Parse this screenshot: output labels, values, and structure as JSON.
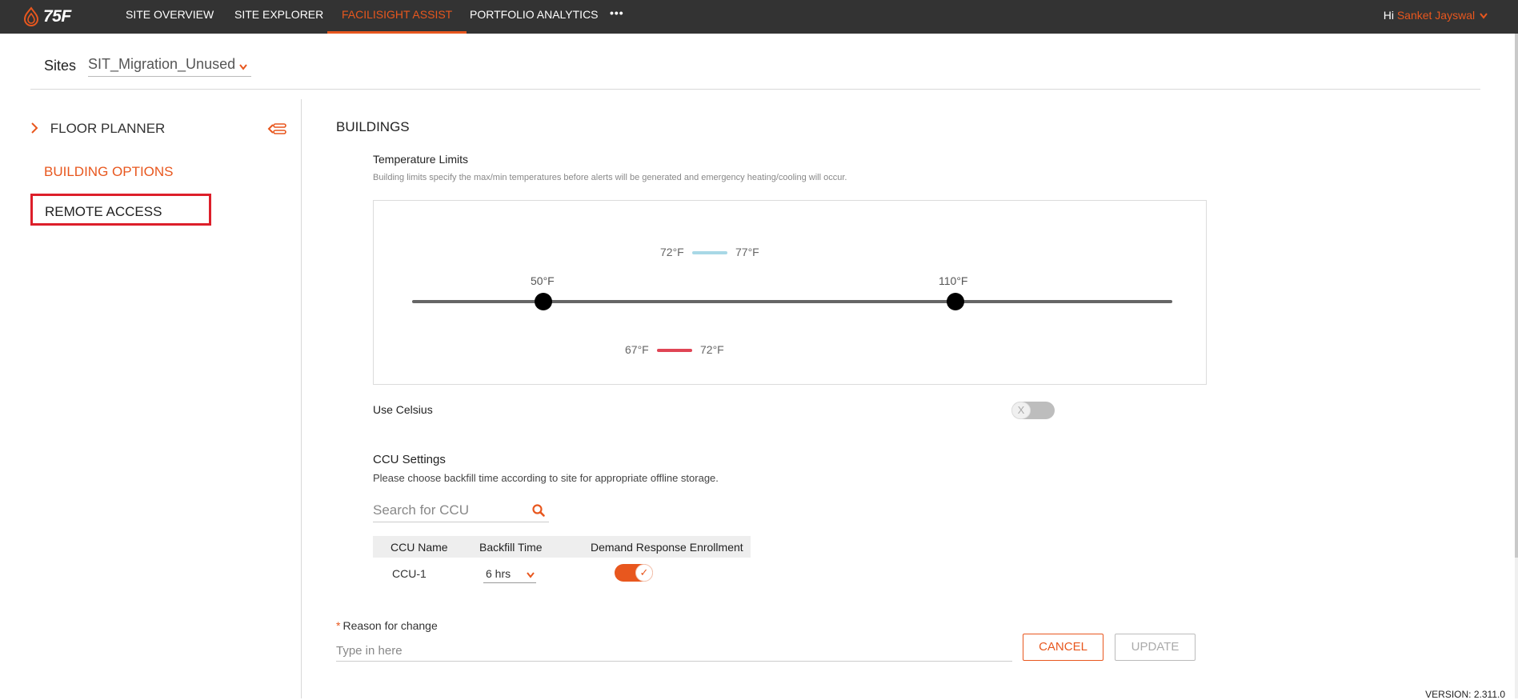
{
  "header": {
    "logo_text": "75F",
    "nav": [
      {
        "label": "SITE OVERVIEW"
      },
      {
        "label": "SITE EXPLORER"
      },
      {
        "label": "FACILISIGHT ASSIST"
      },
      {
        "label": "PORTFOLIO ANALYTICS"
      }
    ],
    "more_label": "•••",
    "greeting_prefix": "Hi",
    "user_name": "Sanket Jayswal",
    "accent_color": "#e8571e"
  },
  "sites": {
    "label": "Sites",
    "selected": "SIT_Migration_Unused"
  },
  "sidebar": {
    "floor_planner": "FLOOR PLANNER",
    "building_options": "BUILDING OPTIONS",
    "remote_access": "REMOTE ACCESS"
  },
  "main": {
    "title": "BUILDINGS",
    "temperature": {
      "title": "Temperature Limits",
      "description": "Building limits specify the max/min temperatures before alerts will be generated and emergency heating/cooling will occur.",
      "min_label": "50°F",
      "max_label": "110°F",
      "min_value": 50,
      "max_value": 110,
      "cooling_low": "72°F",
      "cooling_high": "77°F",
      "heating_low": "67°F",
      "heating_high": "72°F",
      "cooling_color": "#a8d8e6",
      "heating_color": "#e04555"
    },
    "use_celsius": {
      "label": "Use Celsius",
      "enabled": false,
      "knob_glyph": "X"
    },
    "ccu": {
      "title": "CCU Settings",
      "description": "Please choose backfill time according to site for appropriate offline storage.",
      "search_placeholder": "Search for CCU",
      "columns": [
        "CCU Name",
        "Backfill Time",
        "Demand Response Enrollment"
      ],
      "rows": [
        {
          "name": "CCU-1",
          "backfill": "6 hrs",
          "demand_response": true
        }
      ],
      "check_glyph": "✓"
    },
    "reason": {
      "required_mark": "*",
      "label": "Reason for change",
      "placeholder": "Type in here"
    },
    "buttons": {
      "cancel": "CANCEL",
      "update": "UPDATE"
    }
  },
  "footer": {
    "version": "VERSION: 2.311.0"
  }
}
